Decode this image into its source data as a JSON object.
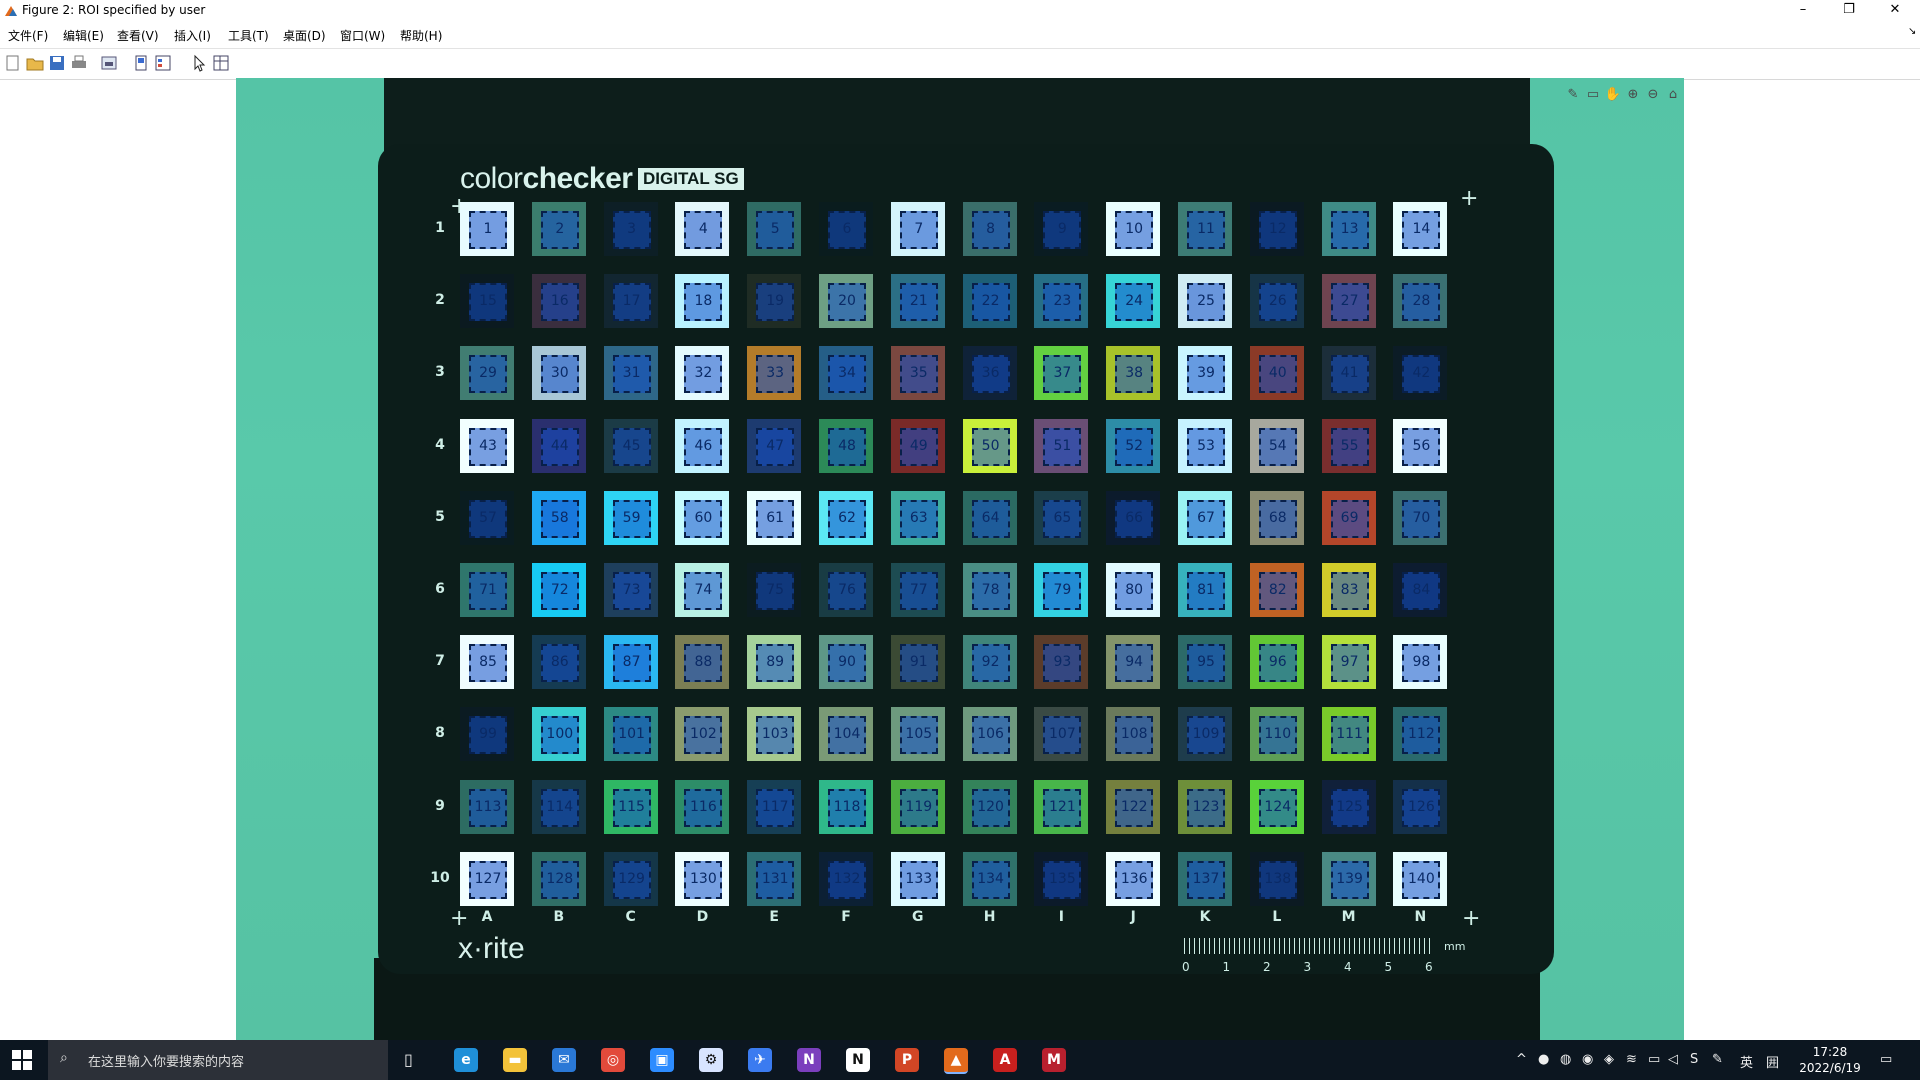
{
  "window": {
    "title": "Figure 2: ROI specified by user",
    "minimize": "–",
    "restore": "❐",
    "close": "✕"
  },
  "menu": [
    "文件(F)",
    "编辑(E)",
    "查看(V)",
    "插入(I)",
    "工具(T)",
    "桌面(D)",
    "窗口(W)",
    "帮助(H)"
  ],
  "toolbar_icons": [
    "new-figure-icon",
    "open-icon",
    "save-icon",
    "print-icon",
    "print-preview-icon",
    "link-plot-icon",
    "insert-legend-icon",
    "select-cursor-icon",
    "property-inspector-icon"
  ],
  "figure_tools": [
    "✎",
    "▭",
    "✋",
    "⊕",
    "⊖",
    "⌂"
  ],
  "chart_card": {
    "brand_light": "color",
    "brand_bold": "checker",
    "brand_tag": "DIGITAL SG",
    "maker": "x·rite",
    "row_labels": [
      "1",
      "2",
      "3",
      "4",
      "5",
      "6",
      "7",
      "8",
      "9",
      "10"
    ],
    "col_labels": [
      "A",
      "B",
      "C",
      "D",
      "E",
      "F",
      "G",
      "H",
      "I",
      "J",
      "K",
      "L",
      "M",
      "N"
    ],
    "ruler_numbers": [
      "0",
      "1",
      "2",
      "3",
      "4",
      "5",
      "6"
    ],
    "ruler_unit": "mm",
    "patch_colors": [
      [
        "#e8fbff",
        "#3b7d6d",
        "#0d1f26",
        "#e4f7fb",
        "#2f6b64",
        "#0a1c1e",
        "#d4f4fb",
        "#3a6e6a",
        "#0a1c22",
        "#eaffff",
        "#3d7c75",
        "#0b1a22",
        "#3f8b86",
        "#eaffff"
      ],
      [
        "#0b1a20",
        "#3a2e3e",
        "#122631",
        "#b9f2ff",
        "#1f2c24",
        "#6e9f84",
        "#2b6f85",
        "#1d5f76",
        "#266f86",
        "#37d4d6",
        "#d0ecf4",
        "#163446",
        "#6f4450",
        "#3a7072"
      ],
      [
        "#417d72",
        "#a8c7d6",
        "#2e6788",
        "#e4fbff",
        "#b47c2a",
        "#255e87",
        "#7b4840",
        "#0f2238",
        "#63d141",
        "#a8c22a",
        "#c9f5ff",
        "#8b3a27",
        "#1c2e3a",
        "#0c1c26"
      ],
      [
        "#f2ffff",
        "#2a2f6e",
        "#1b3b46",
        "#c2f3ff",
        "#1d3b70",
        "#2c8a58",
        "#7a2a28",
        "#c9f03a",
        "#6a4e75",
        "#2d8da7",
        "#c6f2ff",
        "#a7a89e",
        "#7a2e2e",
        "#f2ffff"
      ],
      [
        "#0a1c20",
        "#1ea8f3",
        "#2ed4f4",
        "#c5fbff",
        "#eaffff",
        "#5ce8f4",
        "#3eae9d",
        "#2b6a62",
        "#1b3e4a",
        "#0c1b2c",
        "#9af2f4",
        "#8b8c72",
        "#b4462a",
        "#3c7070"
      ],
      [
        "#2f766c",
        "#17cbf3",
        "#1e3f5c",
        "#b8f0e4",
        "#0c1c20",
        "#193c44",
        "#1d4c52",
        "#4a8e84",
        "#33d2e2",
        "#e2fbff",
        "#37b2bd",
        "#c06224",
        "#d2cc2a",
        "#0d1c30"
      ],
      [
        "#effdff",
        "#153b52",
        "#2ab8f1",
        "#7b7e54",
        "#a5d29c",
        "#5e9787",
        "#3b4a34",
        "#40857a",
        "#5b3c2a",
        "#83936a",
        "#2c6a68",
        "#62c735",
        "#b4e03b",
        "#eaffff"
      ],
      [
        "#0b1b22",
        "#37d0d0",
        "#2c8a84",
        "#8b9c6e",
        "#a7c98e",
        "#7a9a76",
        "#6d9a7e",
        "#6e9a7e",
        "#3a4a44",
        "#6b7a5c",
        "#1e3c4c",
        "#5e9f56",
        "#7acc2a",
        "#2a6a6c"
      ],
      [
        "#2d6c62",
        "#163848",
        "#2fb864",
        "#2d8d68",
        "#163f55",
        "#2fb88a",
        "#4cae3f",
        "#34835a",
        "#48b64a",
        "#75803e",
        "#6e8f3a",
        "#59d23a",
        "#10203a",
        "#14304a"
      ],
      [
        "#f2ffff",
        "#306f66",
        "#143648",
        "#eefeff",
        "#2c6e74",
        "#0c2034",
        "#dffbff",
        "#2f726a",
        "#0c1a2a",
        "#f0ffff",
        "#2e7070",
        "#0c1a22",
        "#4a8a84",
        "#eaffff"
      ]
    ]
  },
  "taskbar": {
    "search_placeholder": "在这里输入你要搜索的内容",
    "apps": [
      "edge-icon",
      "file-explorer-icon",
      "mail-icon",
      "chrome-icon",
      "zoom-icon",
      "vsgraph-icon",
      "feishu-icon",
      "onenote-icon",
      "notion-icon",
      "powerpoint-icon",
      "matlab-icon",
      "acrobat-icon",
      "mendeley-icon"
    ],
    "tray_lang": "英",
    "tray_ime": "囲",
    "time": "17:28",
    "date": "2022/6/19"
  }
}
